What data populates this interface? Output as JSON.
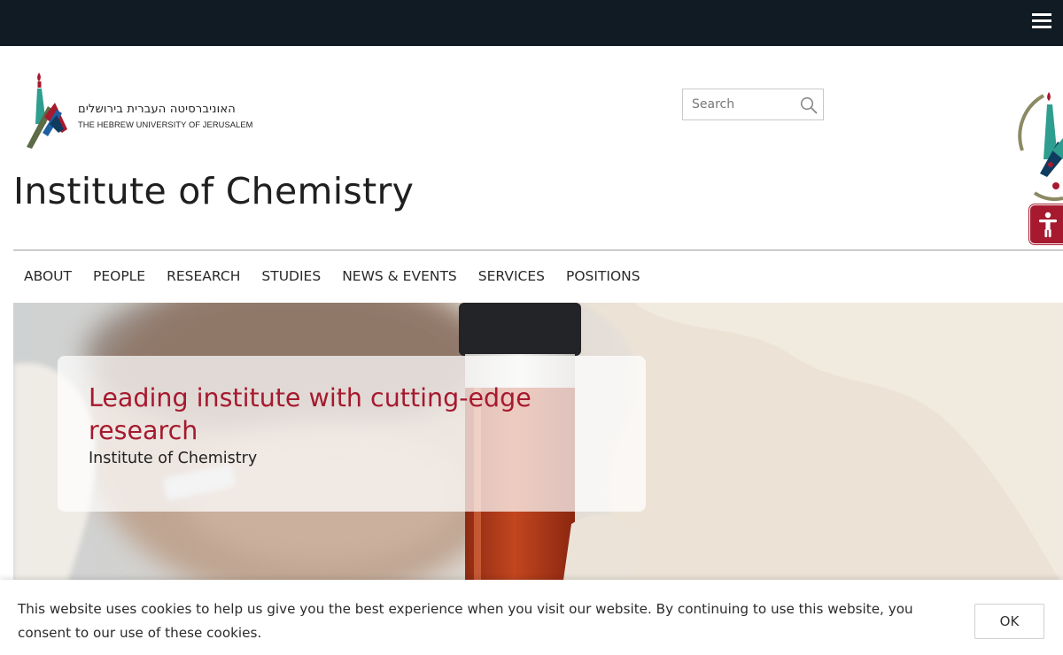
{
  "header": {
    "logo_hebrew": "האוניברסיטה העברית בירושלים",
    "logo_english": "THE HEBREW UNIVERSITY OF JERUSALEM",
    "menu_icon": "hamburger-menu-icon"
  },
  "search": {
    "placeholder": "Search",
    "icon": "search-icon"
  },
  "site_title": "Institute of Chemistry",
  "nav": {
    "items": [
      "ABOUT",
      "PEOPLE",
      "RESEARCH",
      "STUDIES",
      "NEWS & EVENTS",
      "SERVICES",
      "POSITIONS"
    ]
  },
  "hero": {
    "title": "Leading institute with cutting-edge research",
    "subtitle": "Institute of Chemistry"
  },
  "accessibility": {
    "icon": "accessibility-icon"
  },
  "cookie": {
    "text": "This website uses cookies to help us give you the best experience when you visit our website. By continuing to use this website, you consent to our use of these cookies.",
    "ok_label": "OK"
  },
  "colors": {
    "topbar": "#101b24",
    "brand_red": "#a6192e",
    "teal": "#2e9e8f"
  }
}
